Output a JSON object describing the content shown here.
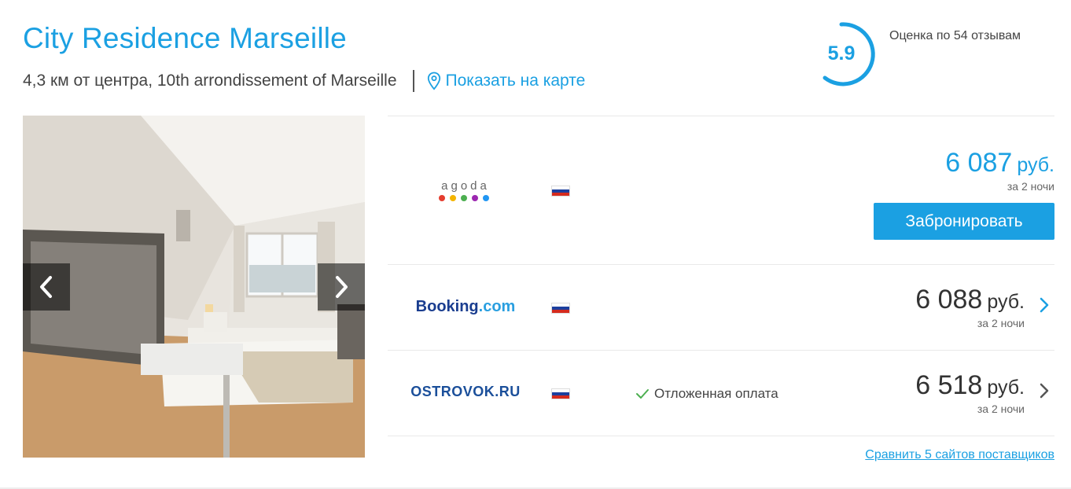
{
  "hotel": {
    "name": "City Residence Marseille",
    "location": "4,3 км от центра, 10th arrondissement of Marseille",
    "map_link": "Показать на карте"
  },
  "rating": {
    "score": "5.9",
    "score_fraction": 0.59,
    "reviews_text": "Оценка по 54 отзывам",
    "accent_color": "#1ba0e2"
  },
  "gallery": {
    "prev_icon": "chevron-left-icon",
    "next_icon": "chevron-right-icon"
  },
  "offers": [
    {
      "provider": "agoda",
      "flag_icon": "russia-flag-icon",
      "price": "6 087",
      "currency": "руб.",
      "nights": "за 2 ночи",
      "button": "Забронировать",
      "highlight": true
    },
    {
      "provider": "Booking.com",
      "logo_main": "Booking",
      "logo_suffix": ".com",
      "flag_icon": "russia-flag-icon",
      "price": "6 088",
      "currency": "руб.",
      "nights": "за 2 ночи"
    },
    {
      "provider": "OSTROVOK.RU",
      "logo_text": "OSTROVOK.RU",
      "flag_icon": "russia-flag-icon",
      "feature": "Отложенная оплата",
      "price": "6 518",
      "currency": "руб.",
      "nights": "за 2 ночи"
    }
  ],
  "compare_link": "Сравнить 5 сайтов поставщиков",
  "colors": {
    "brand_blue": "#1ba0e2",
    "booking_dark": "#1a3d8f",
    "booking_light": "#2a9fe0"
  }
}
